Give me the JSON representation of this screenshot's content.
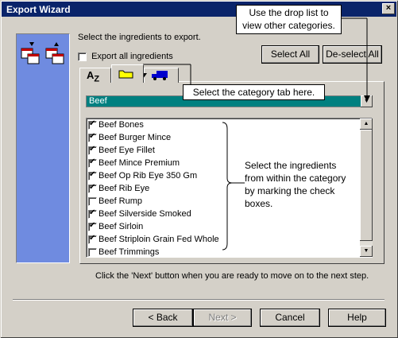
{
  "window": {
    "title": "Export Wizard",
    "close_glyph": "×"
  },
  "instructions": {
    "select_label": "Select the ingredients to export.",
    "footer_hint": "Click the 'Next' button when you are ready to move on to the next step."
  },
  "export_all": {
    "label": "Export all ingredients",
    "checked": false
  },
  "buttons": {
    "select_all": "Select All",
    "deselect_all": "De-select All",
    "back": "< Back",
    "next": "Next >",
    "cancel": "Cancel",
    "help": "Help"
  },
  "tabs": [
    {
      "icon": "alphabetical-sort-icon",
      "label": "AZ",
      "active": false
    },
    {
      "icon": "folder-icon",
      "active": true
    },
    {
      "icon": "truck-icon",
      "active": false
    }
  ],
  "category": {
    "selected": "Beef"
  },
  "ingredients": [
    {
      "label": "Beef Bones",
      "checked": true
    },
    {
      "label": "Beef Burger Mince",
      "checked": true
    },
    {
      "label": "Beef Eye Fillet",
      "checked": true
    },
    {
      "label": "Beef Mince Premium",
      "checked": true
    },
    {
      "label": "Beef Op Rib Eye 350 Gm",
      "checked": true
    },
    {
      "label": "Beef Rib Eye",
      "checked": true
    },
    {
      "label": "Beef Rump",
      "checked": false
    },
    {
      "label": "Beef Silverside Smoked",
      "checked": true
    },
    {
      "label": "Beef Sirloin",
      "checked": true
    },
    {
      "label": "Beef Striploin Grain Fed Whole",
      "checked": true
    },
    {
      "label": "Beef Trimmings",
      "checked": false
    }
  ],
  "callouts": {
    "droplist": [
      "Use the drop list to",
      "view other categories."
    ],
    "tab": "Select the category tab here.",
    "check": [
      "Select the ingredients",
      "from within the category",
      "by marking the check",
      "boxes."
    ]
  },
  "colors": {
    "titlebar": "#0a246a",
    "left_panel": "#6f8be0",
    "combo": "#008080"
  }
}
